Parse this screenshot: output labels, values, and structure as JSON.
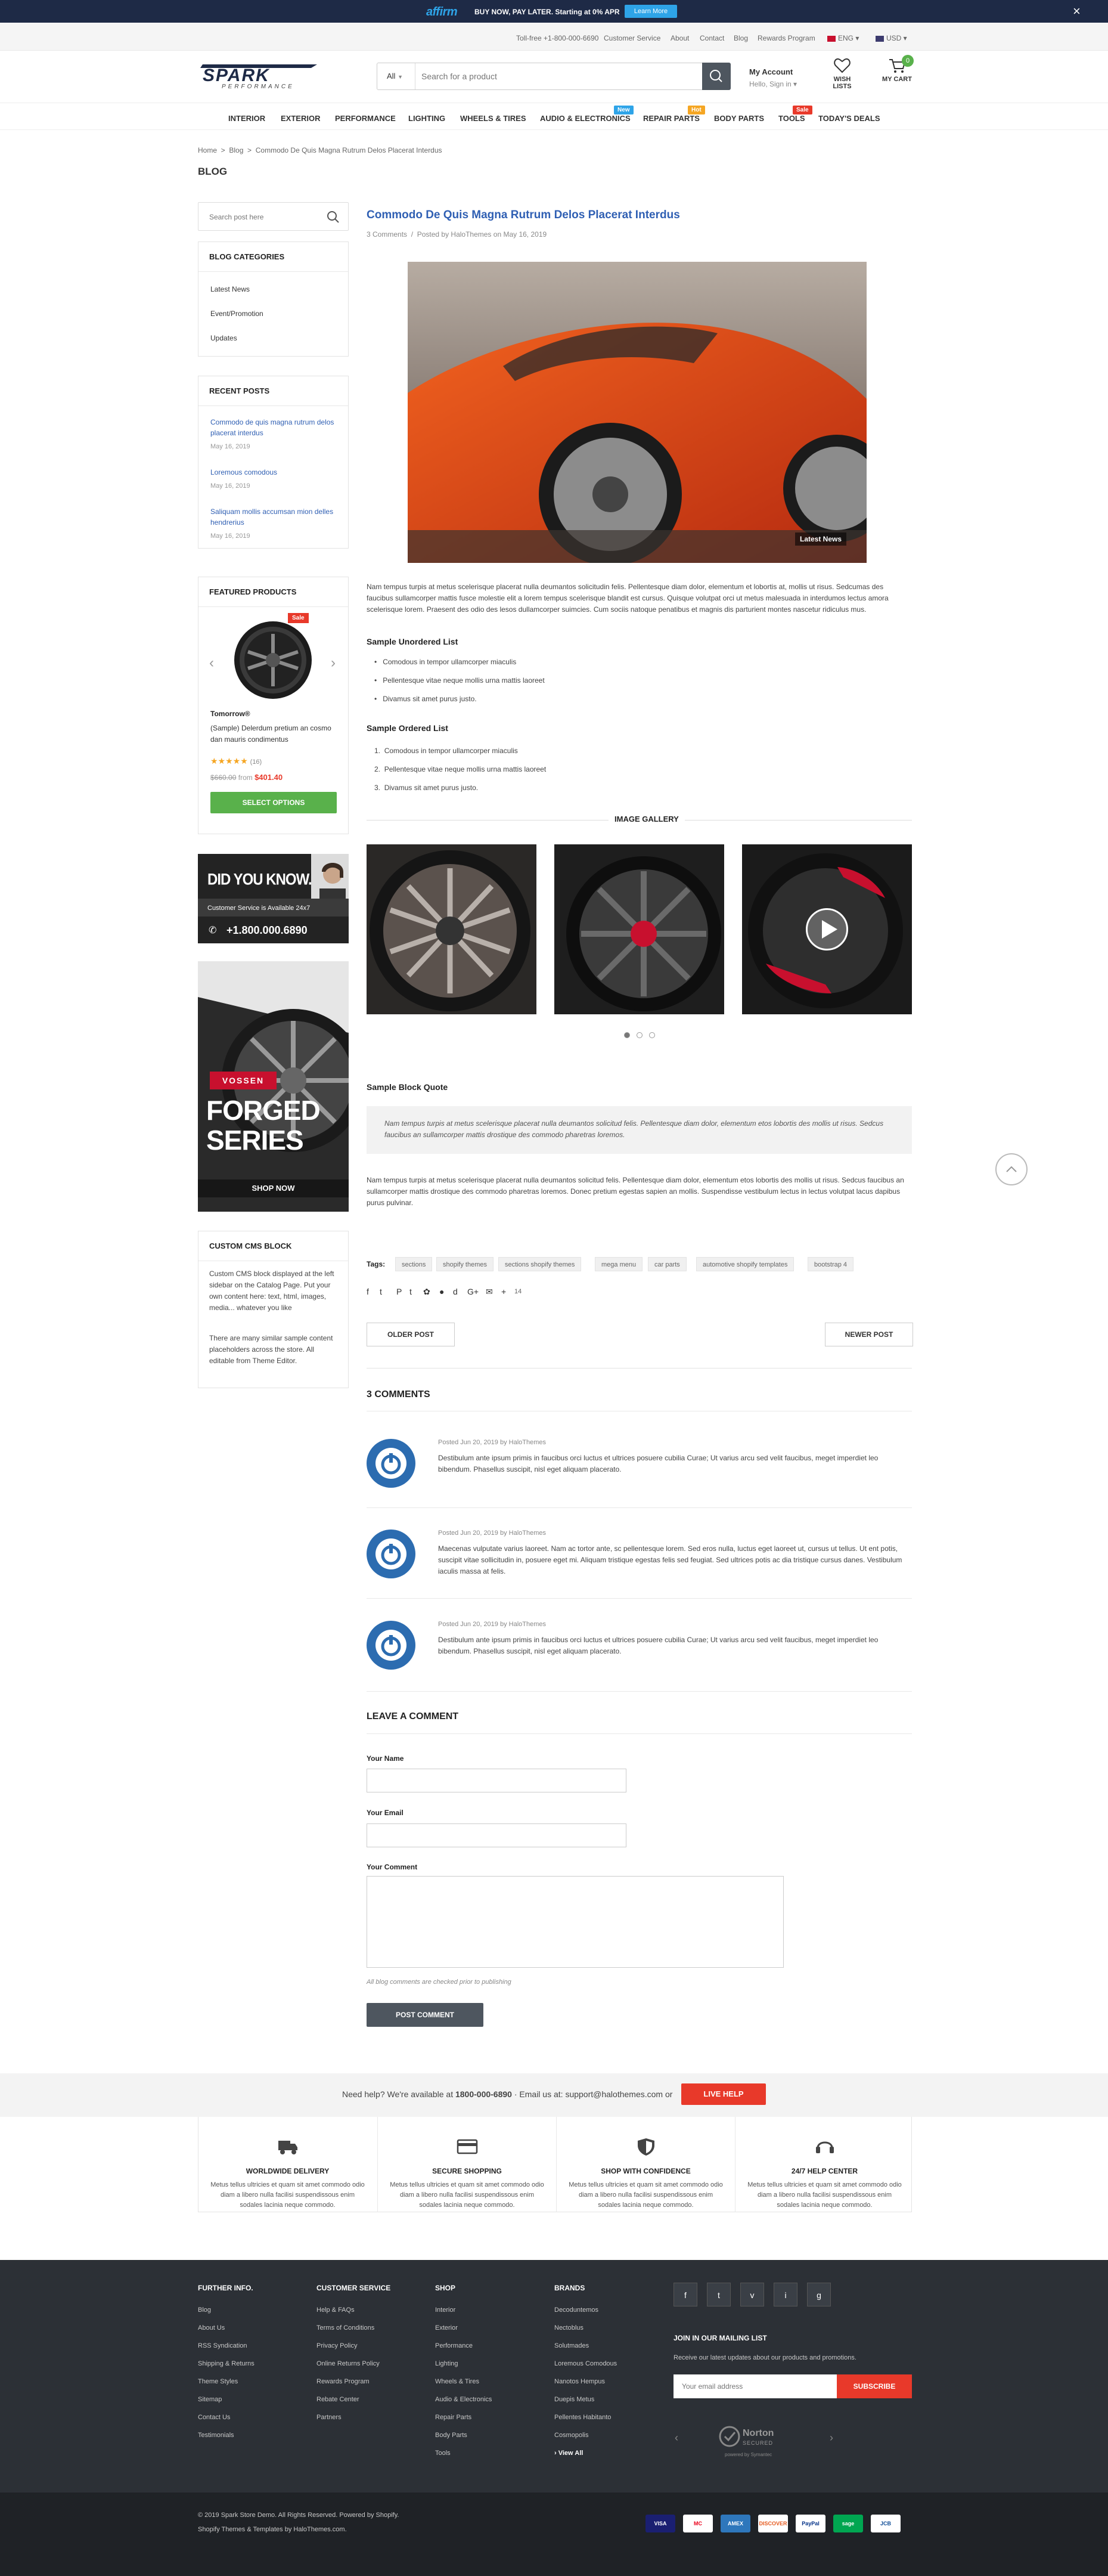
{
  "promo": {
    "brand": "affirm",
    "text": "BUY NOW, PAY LATER. Starting at 0% APR",
    "button": "Learn More"
  },
  "toplinks": {
    "phone": "Toll-free +1-800-000-6690",
    "links": [
      "Customer Service",
      "About",
      "Contact",
      "Blog",
      "Rewards Program"
    ],
    "language": "ENG",
    "currency": "USD"
  },
  "header": {
    "logo_top": "SPARK",
    "logo_sub": "PERFORMANCE",
    "search": {
      "category": "All",
      "placeholder": "Search for a product"
    },
    "account": {
      "title": "My Account",
      "sub": "Hello, Sign in"
    },
    "wishlist": "WISH LISTS",
    "cart": "MY CART",
    "cart_count": "0"
  },
  "nav": {
    "items": [
      "INTERIOR",
      "EXTERIOR",
      "PERFORMANCE",
      "LIGHTING",
      "WHEELS & TIRES",
      "AUDIO & ELECTRONICS",
      "REPAIR PARTS",
      "BODY PARTS",
      "TOOLS",
      "TODAY'S DEALS"
    ],
    "badges": {
      "new": "New",
      "hot": "Hot",
      "sale": "Sale"
    }
  },
  "breadcrumb": {
    "home": "Home",
    "blog": "Blog",
    "current": "Commodo De Quis Magna Rutrum Delos Placerat Interdus"
  },
  "page_title": "BLOG",
  "sidebar": {
    "search_placeholder": "Search post here",
    "categories_title": "BLOG CATEGORIES",
    "categories": [
      "Latest News",
      "Event/Promotion",
      "Updates"
    ],
    "recent_title": "RECENT POSTS",
    "recent": [
      {
        "title": "Commodo de quis magna rutrum delos placerat interdus",
        "date": "May 16, 2019"
      },
      {
        "title": "Loremous comodous",
        "date": "May 16, 2019"
      },
      {
        "title": "Saliquam mollis accumsan mion delles hendrerius",
        "date": "May 16, 2019"
      }
    ],
    "featured_title": "FEATURED PRODUCTS",
    "product": {
      "sale": "Sale",
      "vendor": "Tomorrow®",
      "name": "(Sample) Delerdum pretium an cosmo dan mauris condimentus",
      "reviews": "(16)",
      "old_price": "$660.00",
      "from": "from",
      "price": "$401.40",
      "button": "SELECT OPTIONS"
    },
    "dyk": {
      "title": "DID YOU KNOW.",
      "sub": "Customer Service is Available 24x7",
      "phone": "+1.800.000.6890"
    },
    "forged": {
      "brand": "VOSSEN",
      "line1": "FORGED",
      "line2": "SERIES",
      "button": "SHOP NOW"
    },
    "cms_title": "CUSTOM CMS BLOCK",
    "cms_p1": "Custom CMS block displayed at the left sidebar on the Catalog Page. Put your own content here: text, html, images, media... whatever you like",
    "cms_p2": "There are many similar sample content placeholders across the store. All editable from Theme Editor."
  },
  "post": {
    "title": "Commodo De Quis Magna Rutrum Delos Placerat Interdus",
    "comments_link": "3 Comments",
    "meta": "Posted by HaloThemes on May 16, 2019",
    "image_badge": "Latest News",
    "para1": "Nam tempus turpis at metus scelerisque placerat nulla deumantos solicitudin felis. Pellentesque diam dolor, elementum et lobortis at, mollis ut risus. Sedcumas des faucibus sullamcorper mattis fusce molestie elit a lorem tempus scelerisque blandit est cursus. Quisque volutpat orci ut metus malesuada in interdumos lectus amora scelerisque lorem. Praesent des odio des lesos dullamcorper suimcies. Cum sociis natoque penatibus et magnis dis parturient montes nascetur ridiculus mus.",
    "ul_title": "Sample Unordered List",
    "ul": [
      "Comodous in tempor ullamcorper miaculis",
      "Pellentesque vitae neque mollis urna mattis laoreet",
      "Divamus sit amet purus justo."
    ],
    "ol_title": "Sample Ordered List",
    "ol": [
      "Comodous in tempor ullamcorper miaculis",
      "Pellentesque vitae neque mollis urna mattis laoreet",
      "Divamus sit amet purus justo."
    ],
    "gallery_title": "IMAGE GALLERY",
    "quote_title": "Sample Block Quote",
    "quote": "Nam tempus turpis at metus scelerisque placerat nulla deumantos solicitud felis. Pellentesque diam dolor, elementum etos lobortis des mollis ut risus. Sedcus faucibus an sullamcorper mattis drostique des commodo pharetras loremos.",
    "para2": "Nam tempus turpis at metus scelerisque placerat nulla deumantos solicitud felis. Pellentesque diam dolor, elementum etos lobortis des mollis ut risus. Sedcus faucibus an sullamcorper mattis drostique des commodo pharetras loremos. Donec pretium egestas sapien an mollis. Suspendisse vestibulum lectus in lectus volutpat lacus dapibus purus pulvinar.",
    "tags_label": "Tags:",
    "tags": [
      "sections",
      "shopify themes",
      "sections shopify themes",
      "mega menu",
      "car parts",
      "automotive shopify templates",
      "bootstrap 4"
    ],
    "share_count": "14",
    "older": "OLDER POST",
    "newer": "NEWER POST"
  },
  "comments": {
    "title": "3 COMMENTS",
    "items": [
      {
        "meta": "Posted Jun 20, 2019 by HaloThemes",
        "text": "Destibulum ante ipsum primis in faucibus orci luctus et ultrices posuere cubilia Curae; Ut varius arcu sed velit faucibus, meget imperdiet leo bibendum. Phasellus suscipit, nisl eget aliquam placerato."
      },
      {
        "meta": "Posted Jun 20, 2019 by HaloThemes",
        "text": "Maecenas vulputate varius laoreet. Nam ac tortor ante, sc pellentesque lorem. Sed eros nulla, luctus eget laoreet ut, cursus ut tellus. Ut ent potis, suscipit vitae sollicitudin in, posuere eget mi. Aliquam tristique egestas felis sed feugiat. Sed ultrices potis ac dia tristique cursus danes. Vestibulum iaculis massa at felis."
      },
      {
        "meta": "Posted Jun 20, 2019 by HaloThemes",
        "text": "Destibulum ante ipsum primis in faucibus orci luctus et ultrices posuere cubilia Curae; Ut varius arcu sed velit faucibus, meget imperdiet leo bibendum. Phasellus suscipit, nisl eget aliquam placerato."
      }
    ]
  },
  "form": {
    "title": "LEAVE A COMMENT",
    "name": "Your Name",
    "email": "Your Email",
    "comment": "Your Comment",
    "note": "All blog comments are checked prior to publishing",
    "submit": "POST COMMENT"
  },
  "help": {
    "text_pre": "Need help? We're available at",
    "phone": "1800-000-6890",
    "text_mid": "· Email us at: support@halothemes.com or",
    "button": "LIVE HELP"
  },
  "features": [
    {
      "icon": "truck-icon",
      "title": "WORLDWIDE DELIVERY",
      "desc": "Metus tellus ultricies et quam sit amet commodo odio diam a libero nulla facilisi suspendissous enim sodales lacinia neque commodo."
    },
    {
      "icon": "credit-card-icon",
      "title": "SECURE SHOPPING",
      "desc": "Metus tellus ultricies et quam sit amet commodo odio diam a libero nulla facilisi suspendissous enim sodales lacinia neque commodo."
    },
    {
      "icon": "shield-icon",
      "title": "SHOP WITH CONFIDENCE",
      "desc": "Metus tellus ultricies et quam sit amet commodo odio diam a libero nulla facilisi suspendissous enim sodales lacinia neque commodo."
    },
    {
      "icon": "headset-icon",
      "title": "24/7 HELP CENTER",
      "desc": "Metus tellus ultricies et quam sit amet commodo odio diam a libero nulla facilisi suspendissous enim sodales lacinia neque commodo."
    }
  ],
  "footer": {
    "col1": {
      "title": "FURTHER INFO.",
      "links": [
        "Blog",
        "About Us",
        "RSS Syndication",
        "Shipping & Returns",
        "Theme Styles",
        "Sitemap",
        "Contact Us",
        "Testimonials"
      ]
    },
    "col2": {
      "title": "CUSTOMER SERVICE",
      "links": [
        "Help & FAQs",
        "Terms of Conditions",
        "Privacy Policy",
        "Online Returns Policy",
        "Rewards Program",
        "Rebate Center",
        "Partners"
      ]
    },
    "col3": {
      "title": "SHOP",
      "links": [
        "Interior",
        "Exterior",
        "Performance",
        "Lighting",
        "Wheels & Tires",
        "Audio & Electronics",
        "Repair Parts",
        "Body Parts",
        "Tools"
      ]
    },
    "col4": {
      "title": "BRANDS",
      "links": [
        "Decoduntemos",
        "Nectoblus",
        "Solutmades",
        "Loremous Comodous",
        "Nanotos Hempus",
        "Duepis Metus",
        "Pellentes Habitanto",
        "Cosmopolis"
      ],
      "view_all": "View All"
    },
    "social": [
      "f",
      "t",
      "v",
      "i",
      "g"
    ],
    "mailing_title": "JOIN IN OUR MAILING LIST",
    "mailing_desc": "Receive our latest updates about our products and promotions.",
    "email_placeholder": "Your email address",
    "subscribe": "SUBSCRIBE",
    "norton": "Norton",
    "norton_sub": "SECURED",
    "norton_by": "powered by Symantec",
    "copyright": "© 2019 Spark Store Demo. All Rights Reserved. Powered by Shopify.",
    "credit": "Shopify Themes & Templates by HaloThemes.com.",
    "payments": [
      "VISA",
      "MC",
      "AMEX",
      "DISCOVER",
      "PayPal",
      "sage",
      "JCB"
    ]
  },
  "colors": {
    "accent": "#2f5fb3",
    "cta": "#e8392a",
    "green": "#59b14b",
    "dark": "#2c3036"
  }
}
